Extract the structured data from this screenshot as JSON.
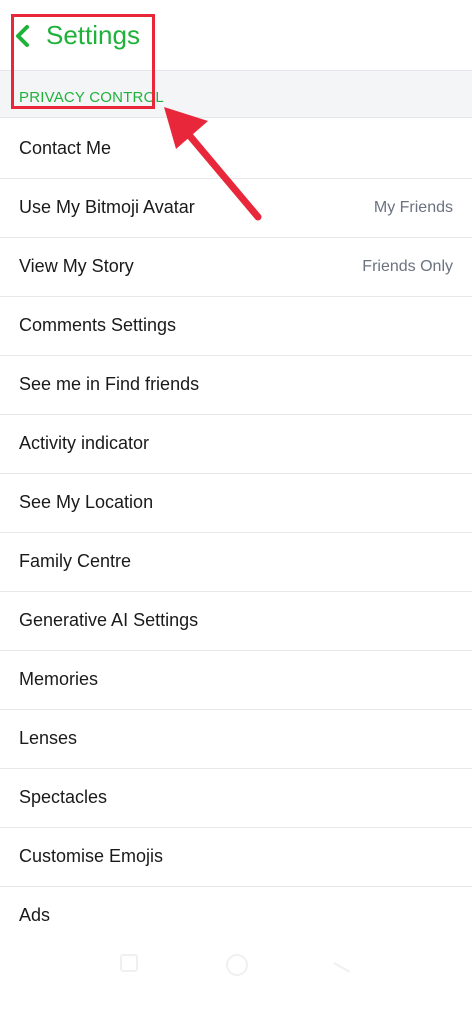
{
  "header": {
    "title": "Settings",
    "back_icon": "chevron-left-icon",
    "accent_color": "#1fb23b"
  },
  "section": {
    "label": "PRIVACY CONTROL"
  },
  "rows": [
    {
      "label": "Contact Me",
      "value": ""
    },
    {
      "label": "Use My Bitmoji Avatar",
      "value": "My Friends"
    },
    {
      "label": "View My Story",
      "value": "Friends Only"
    },
    {
      "label": "Comments Settings",
      "value": ""
    },
    {
      "label": "See me in Find friends",
      "value": ""
    },
    {
      "label": "Activity indicator",
      "value": ""
    },
    {
      "label": "See My Location",
      "value": ""
    },
    {
      "label": "Family Centre",
      "value": ""
    },
    {
      "label": "Generative AI Settings",
      "value": ""
    },
    {
      "label": "Memories",
      "value": ""
    },
    {
      "label": "Lenses",
      "value": ""
    },
    {
      "label": "Spectacles",
      "value": ""
    },
    {
      "label": "Customise Emojis",
      "value": ""
    },
    {
      "label": "Ads",
      "value": ""
    }
  ],
  "annotation": {
    "color": "#e8283a"
  },
  "navbar": {
    "icons": [
      "square-icon",
      "circle-home-icon",
      "back-triangle-icon"
    ]
  }
}
